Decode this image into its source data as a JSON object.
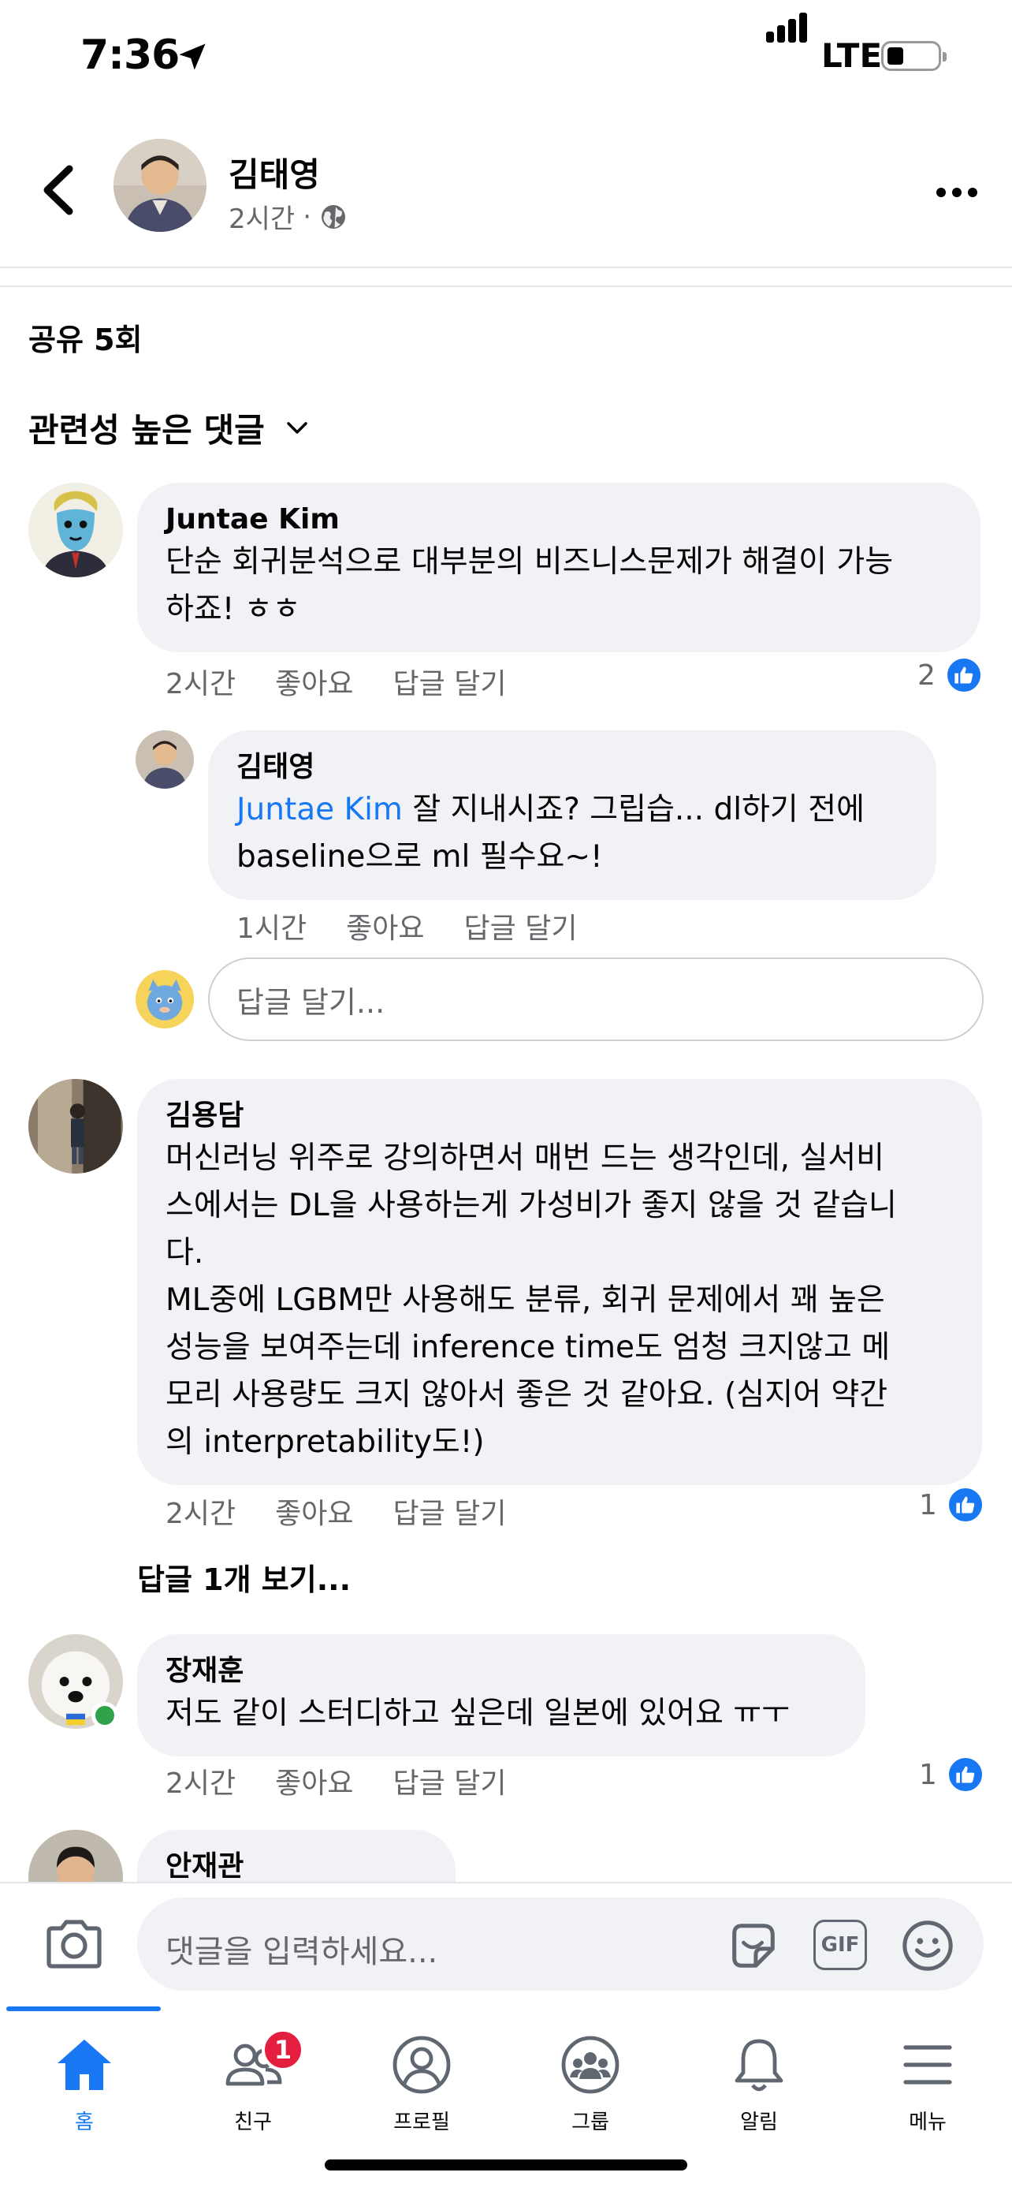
{
  "status": {
    "time": "7:36",
    "network": "LTE"
  },
  "header": {
    "name": "김태영",
    "time": "2시간",
    "separator": "·"
  },
  "post": {
    "shares": "공유 5회",
    "sort_label": "관련성 높은 댓글"
  },
  "actions": {
    "like": "좋아요",
    "reply": "답글 달기"
  },
  "comments": [
    {
      "author": "Juntae Kim",
      "text": "단순 회귀분석으로 대부분의 비즈니스문제가 해결이 가능\n하죠! ㅎㅎ",
      "time": "2시간",
      "likes": "2"
    },
    {
      "author": "김태영",
      "mention": "Juntae Kim",
      "text": " 잘 지내시죠? 그립습... dl하기 전에\nbaseline으로 ml 필수요~!",
      "time": "1시간"
    },
    {
      "author": "김용담",
      "text": "머신러닝 위주로 강의하면서 매번 드는 생각인데, 실서비\n스에서는 DL을 사용하는게 가성비가 좋지 않을 것 같습니\n다.\nML중에 LGBM만 사용해도 분류, 회귀 문제에서 꽤 높은\n성능을 보여주는데 inference time도 엄청 크지않고 메\n모리 사용량도 크지 않아서 좋은 것 같아요. (심지어 약간\n의 interpretability도!)",
      "time": "2시간",
      "likes": "1"
    },
    {
      "author": "장재훈",
      "text": "저도 같이 스터디하고 싶은데 일본에 있어요 ㅠㅜ",
      "time": "2시간",
      "likes": "1"
    },
    {
      "author": "안재관"
    }
  ],
  "reply_placeholder": "답글 달기...",
  "see_replies": "답글 1개 보기...",
  "comment_input": {
    "placeholder": "댓글을 입력하세요...",
    "gif": "GIF"
  },
  "tabs": [
    {
      "label": "홈",
      "icon": "home-icon"
    },
    {
      "label": "친구",
      "icon": "friends-icon",
      "badge": "1"
    },
    {
      "label": "프로필",
      "icon": "profile-icon"
    },
    {
      "label": "그룹",
      "icon": "groups-icon"
    },
    {
      "label": "알림",
      "icon": "bell-icon"
    },
    {
      "label": "메뉴",
      "icon": "menu-icon"
    }
  ],
  "colors": {
    "accent": "#1877f2",
    "bubble": "#f0f2f5",
    "secondary_text": "#65676b",
    "badge": "#e41e3f",
    "online": "#31a24c"
  }
}
